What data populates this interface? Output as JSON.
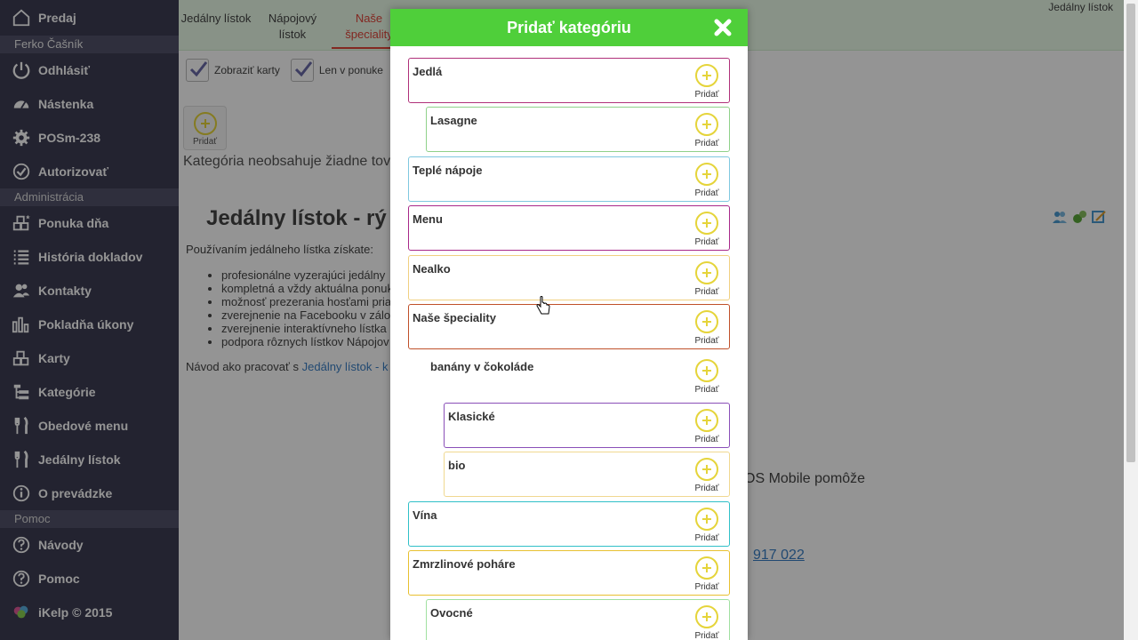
{
  "sidebar": {
    "top_label": "Predaj",
    "user": "Ferko Čašník",
    "items_top": [
      {
        "label": "Odhlásiť",
        "icon": "power-icon"
      },
      {
        "label": "Nástenka",
        "icon": "dashboard-icon"
      },
      {
        "label": "POSm-238",
        "icon": "gear-icon"
      },
      {
        "label": "Autorizovať",
        "icon": "check-circle-icon"
      }
    ],
    "section_admin": "Administrácia",
    "items_admin": [
      {
        "label": "Ponuka dňa",
        "icon": "boxes-star-icon"
      },
      {
        "label": "História dokladov",
        "icon": "list-icon"
      },
      {
        "label": "Kontakty",
        "icon": "users-icon"
      },
      {
        "label": "Pokladňa úkony",
        "icon": "bar-chart-icon"
      },
      {
        "label": "Karty",
        "icon": "boxes-icon"
      },
      {
        "label": "Kategórie",
        "icon": "tree-icon"
      },
      {
        "label": "Obedové menu",
        "icon": "fork-knife-icon"
      },
      {
        "label": "Jedálny lístok",
        "icon": "fork-knife-icon"
      },
      {
        "label": "O prevádzke",
        "icon": "info-icon"
      }
    ],
    "section_help": "Pomoc",
    "items_help": [
      {
        "label": "Návody",
        "icon": "question-icon"
      },
      {
        "label": "Pomoc",
        "icon": "question-icon"
      },
      {
        "label": "iKelp © 2015",
        "icon": "ikelp-logo-icon"
      }
    ]
  },
  "main": {
    "tabs": [
      "Jedálny lístok",
      "Nápojový lístok",
      "Naše špeciality"
    ],
    "breadcrumb": "Jedálny lístok",
    "check_show_cards": "Zobraziť karty",
    "check_in_offer": "Len v ponuke",
    "add_label": "Pridať",
    "empty_text": "Kategória neobsahuje žiadne tov",
    "heading": "Jedálny lístok - rý",
    "intro": "Používaním jedálneho lístka získate:",
    "bullets": [
      "profesionálne vyzerajúci jedálny",
      "kompletná a vždy aktuálna ponuk",
      "možnosť prezerania hosťami pria",
      "zverejnenie na Facebooku v zálo",
      "zverejnenie interaktívneho lístka",
      "podpora rôznych lístkov Nápojov"
    ],
    "guide_prefix": "Návod ako pracovať s",
    "guide_link": "Jedálny lístok - k",
    "right_text": "OS Mobile pomôže",
    "right_phone": "917 022"
  },
  "modal": {
    "title": "Pridať kategóriu",
    "add_label": "Pridať",
    "categories": [
      {
        "name": "Jedlá",
        "color": "#b0307a"
      },
      {
        "name": "Lasagne",
        "color": "#8fd18a"
      },
      {
        "name": "Teplé nápoje",
        "color": "#7fc8e0"
      },
      {
        "name": "Menu",
        "color": "#a8288a"
      },
      {
        "name": "Nealko",
        "color": "#f0d080"
      },
      {
        "name": "Naše špeciality",
        "color": "#c0502a"
      },
      {
        "name": "banány v čokoláde",
        "color": ""
      },
      {
        "name": "Klasické",
        "color": "#8a4fb8"
      },
      {
        "name": "bio",
        "color": "#f0d890"
      },
      {
        "name": "Vína",
        "color": "#30c0c8"
      },
      {
        "name": "Zmrzlinové poháre",
        "color": "#e8c030"
      },
      {
        "name": "Ovocné",
        "color": "#a0e0a0"
      }
    ]
  }
}
